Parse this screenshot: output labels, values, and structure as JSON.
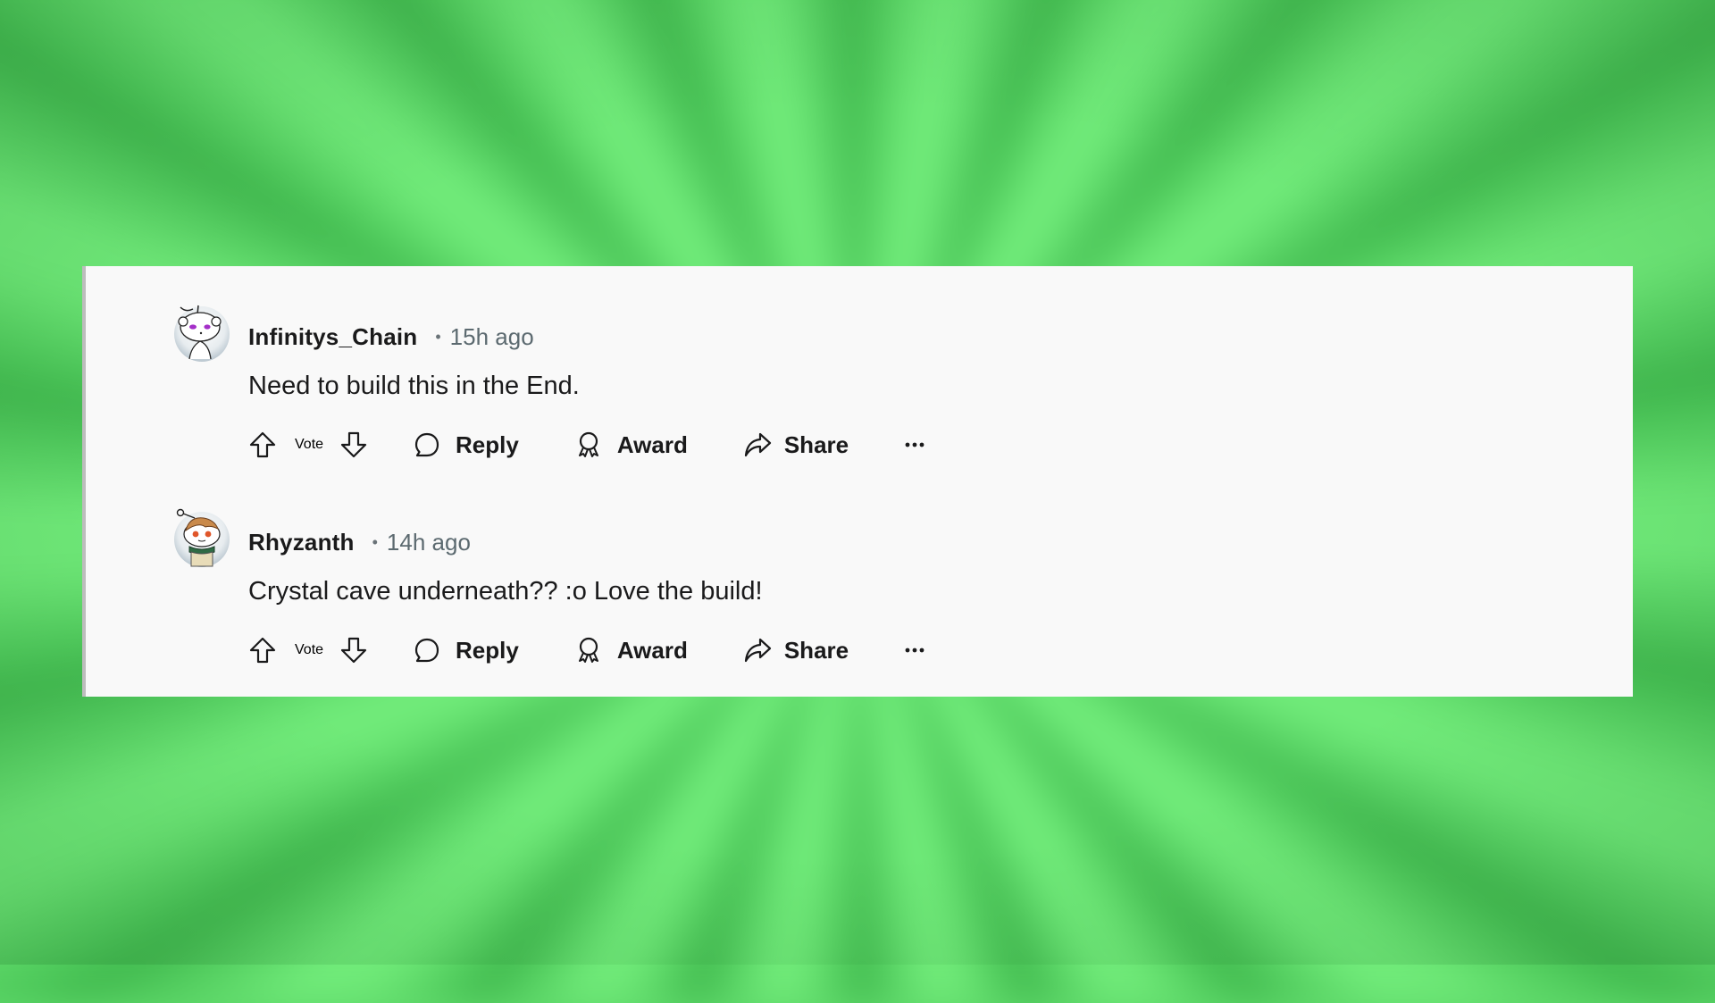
{
  "background": {
    "style": "blurred green starburst",
    "colors": {
      "dark": "#3fb54c",
      "light": "#72ec7b"
    }
  },
  "comments": [
    {
      "username": "Infinitys_Chain",
      "separator": "•",
      "timestamp": "15h ago",
      "avatar": "snoo-avatar-purple-eyes",
      "body": "Need to build this in the End.",
      "actions": {
        "vote": "Vote",
        "reply": "Reply",
        "award": "Award",
        "share": "Share",
        "more": "more-options"
      }
    },
    {
      "username": "Rhyzanth",
      "separator": "•",
      "timestamp": "14h ago",
      "avatar": "snoo-avatar-brown-hair-green-scarf",
      "body": "Crystal cave underneath?? :o Love the build!",
      "actions": {
        "vote": "Vote",
        "reply": "Reply",
        "award": "Award",
        "share": "Share",
        "more": "more-options"
      }
    }
  ],
  "colors": {
    "card_bg": "#f9f9f9",
    "text": "#1a1a1b",
    "meta": "#5c6a70",
    "card_border": "#bdbdbd"
  }
}
